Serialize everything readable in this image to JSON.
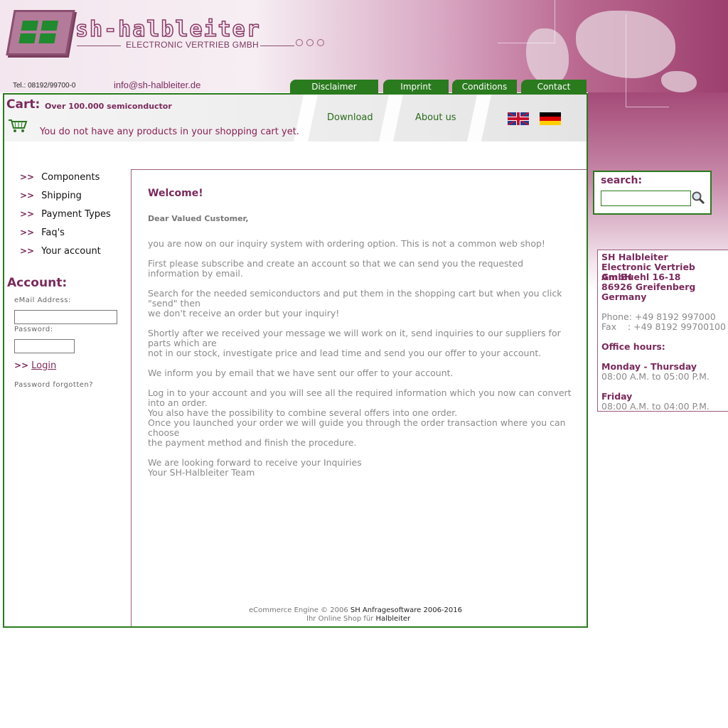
{
  "brand": {
    "logo_text": "sh-halbleiter",
    "subtitle": "ELECTRONIC VERTRIEB GMBH",
    "tel": "Tel.: 08192/99700-0",
    "email": "info@sh-halbleiter.de"
  },
  "top_tabs": [
    "Disclaimer",
    "Imprint",
    "Conditions",
    "Contact"
  ],
  "cart": {
    "label": "Cart:",
    "tagline": "Over 100.000 semiconductor",
    "empty_message": "You do not have any products in your shopping cart yet."
  },
  "nav": {
    "download": "Download",
    "about": "About us"
  },
  "languages": [
    "English",
    "Deutsch"
  ],
  "menu": [
    "Components",
    "Shipping",
    "Payment Types",
    "Faq's",
    "Your account"
  ],
  "account": {
    "title": "Account:",
    "email_label": "eMail Address:",
    "password_label": "Password:",
    "login": "Login",
    "forgot": "Password forgotten?"
  },
  "main": {
    "welcome": "Welcome!",
    "greeting": "Dear Valued Customer,",
    "p1": "you are now on our inquiry system with ordering option. This is not a common web shop!",
    "p2": "First please subscribe and create an account so that we can send you the requested information by email.",
    "p3a": "Search for the needed semiconductors and put them in the shopping cart but when you click \"send\" then",
    "p3b": "we don't receive an order but your inquiry!",
    "p4a": "Shortly after we received your message we will work on it, send inquiries to our suppliers for parts which are",
    "p4b": "not in our stock, investigate price and lead time and send you our offer to your account.",
    "p5": "We inform you by email that we have sent our offer to your account.",
    "p6a": "Log in to your account and you will see all the required information which you now can convert into an order.",
    "p6b": "You also have the possibility to combine several offers into one order.",
    "p6c": "Once you launched your order we will guide you through the order transaction where you can choose",
    "p6d": "the payment method and finish the procedure.",
    "p7a": "We are looking forward to receive your Inquiries",
    "p7b": "Your SH-Halbleiter Team"
  },
  "footer": {
    "engine": "eCommerce Engine © 2006",
    "engine_link": "SH Anfragesoftware 2006-2016",
    "shop": "Ihr Online Shop für",
    "shop_link": "Halbleiter"
  },
  "search": {
    "label": "search:",
    "value": ""
  },
  "contact": {
    "address": [
      "SH Halbleiter",
      "Electronic Vertrieb GmbH",
      "Am Buehl 16-18",
      "86926 Greifenberg",
      "Germany"
    ],
    "phone": "Phone: +49 8192 997000",
    "fax": "Fax    : +49 8192 99700100",
    "office_title": "Office hours:",
    "days1": "Monday - Thursday",
    "hours1": "08:00 A.M. to 05:00 P.M.",
    "days2": "Friday",
    "hours2": "08:00 A.M. to 04:00 P.M."
  },
  "colors": {
    "accent": "#7a2a5c",
    "green": "#2a7a1e"
  }
}
